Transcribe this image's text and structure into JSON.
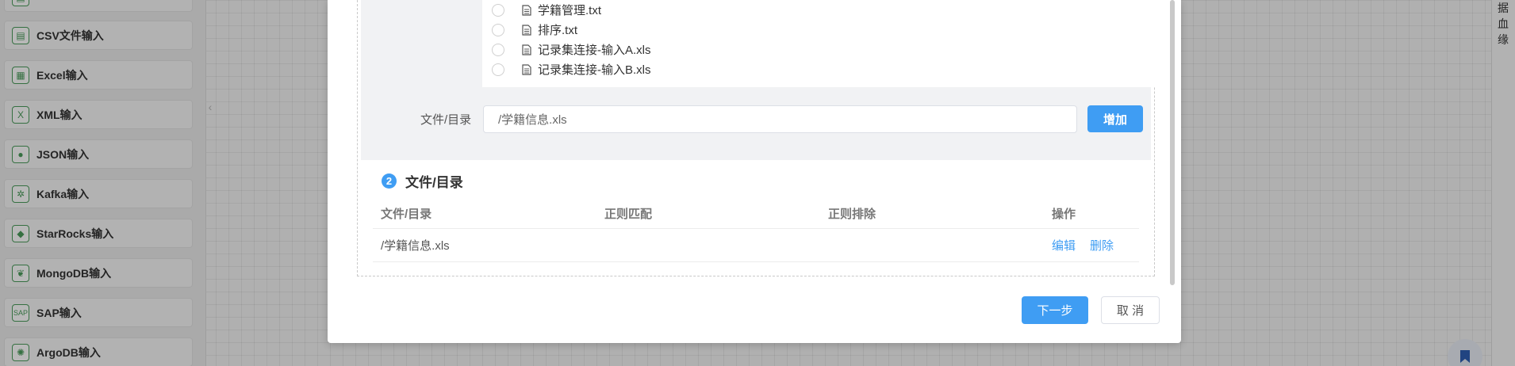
{
  "palette": {
    "items": [
      {
        "label": "",
        "icon": "file-input-icon"
      },
      {
        "label": "CSV文件输入",
        "icon": "csv-icon"
      },
      {
        "label": "Excel输入",
        "icon": "excel-icon"
      },
      {
        "label": "XML输入",
        "icon": "xml-icon"
      },
      {
        "label": "JSON输入",
        "icon": "json-icon"
      },
      {
        "label": "Kafka输入",
        "icon": "kafka-icon"
      },
      {
        "label": "StarRocks输入",
        "icon": "starrocks-icon"
      },
      {
        "label": "MongoDB输入",
        "icon": "mongodb-icon"
      },
      {
        "label": "SAP输入",
        "icon": "sap-icon"
      },
      {
        "label": "ArgoDB输入",
        "icon": "argodb-icon"
      }
    ]
  },
  "right_strip": {
    "chars": [
      "据",
      "血",
      "缘"
    ]
  },
  "modal": {
    "file_list": [
      {
        "name": "学籍管理.txt"
      },
      {
        "name": "排序.txt"
      },
      {
        "name": "记录集连接-输入A.xls"
      },
      {
        "name": "记录集连接-输入B.xls"
      }
    ],
    "dir_label": "文件/目录",
    "dir_input_value": "/学籍信息.xls",
    "add_label": "增加",
    "section": {
      "number": "2",
      "title": "文件/目录"
    },
    "table": {
      "headers": [
        "文件/目录",
        "正则匹配",
        "正则排除",
        "操作"
      ],
      "rows": [
        {
          "path": "/学籍信息.xls",
          "regex_match": "",
          "regex_exclude": "",
          "edit": "编辑",
          "delete": "删除"
        }
      ]
    },
    "next_label": "下一步",
    "cancel_label": "取 消"
  },
  "colors": {
    "primary": "#3f9df3",
    "icon_green": "#4a9b5a"
  }
}
